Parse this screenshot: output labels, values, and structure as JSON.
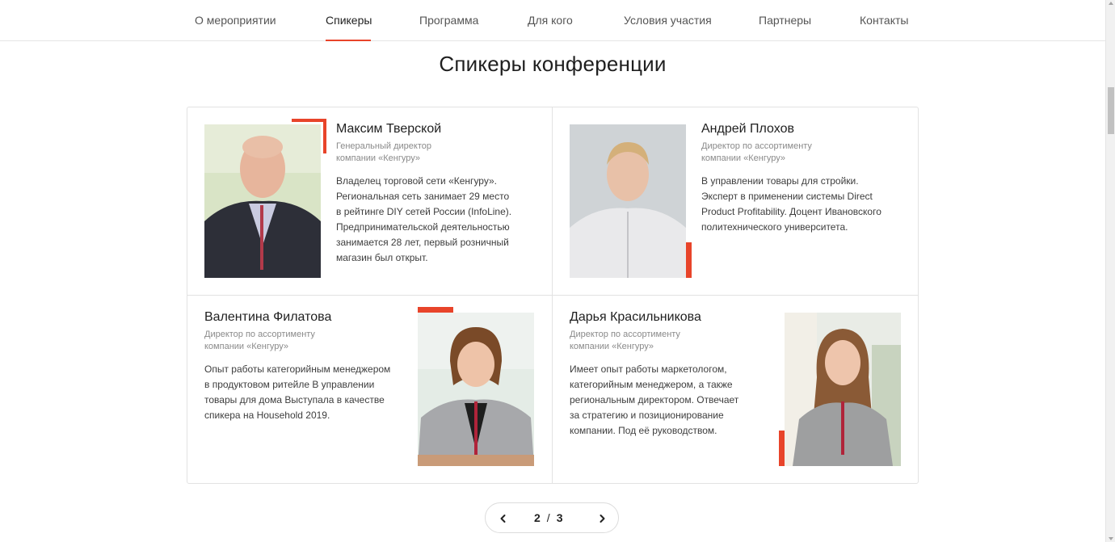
{
  "nav": {
    "items": [
      {
        "label": "О мероприятии"
      },
      {
        "label": "Спикеры"
      },
      {
        "label": "Программа"
      },
      {
        "label": "Для кого"
      },
      {
        "label": "Условия участия"
      },
      {
        "label": "Партнеры"
      },
      {
        "label": "Контакты"
      }
    ],
    "active": "Спикеры"
  },
  "section": {
    "title": "Спикеры конференции"
  },
  "speakers": [
    {
      "name": "Максим Тверской",
      "role_line1": "Генеральный директор",
      "role_line2": "компании «Кенгуру»",
      "bio": [
        "Владелец торговой сети «Кенгуру».",
        "Региональная сеть занимает 29 место",
        "в рейтинге DIY сетей России (InfoLine).",
        "Предпринимательской деятельностью",
        "занимается 28 лет, первый розничный",
        "магазин был открыт."
      ]
    },
    {
      "name": "Андрей Плохов",
      "role_line1": "Директор по ассортименту",
      "role_line2": "компании «Кенгуру»",
      "bio": [
        "В управлении товары для стройки.",
        "Эксперт в применении системы Direct",
        "Product Profitability. Доцент Ивановского",
        "политехнического университета."
      ]
    },
    {
      "name": "Валентина Филатова",
      "role_line1": "Директор по ассортименту",
      "role_line2": "компании «Кенгуру»",
      "bio": [
        "Опыт работы категорийным менеджером",
        "в продуктовом ритейле В управлении",
        "товары для дома Выступала в качестве",
        "спикера на Household 2019."
      ]
    },
    {
      "name": "Дарья Красильникова",
      "role_line1": "Директор по ассортименту",
      "role_line2": "компании «Кенгуру»",
      "bio": [
        "Имеет опыт работы маркетологом,",
        "категорийным менеджером, а также",
        "региональным директором. Отвечает",
        "за стратегию и позиционирование",
        "компании. Под её руководством."
      ]
    }
  ],
  "pager": {
    "current": "2",
    "separator": "/",
    "total": "3"
  },
  "colors": {
    "accent": "#e8442a",
    "border": "#e2e2e2",
    "text": "#1f1f1f",
    "muted": "#8a8a8a"
  },
  "icons": {
    "prev": "chevron-left-icon",
    "next": "chevron-right-icon"
  }
}
